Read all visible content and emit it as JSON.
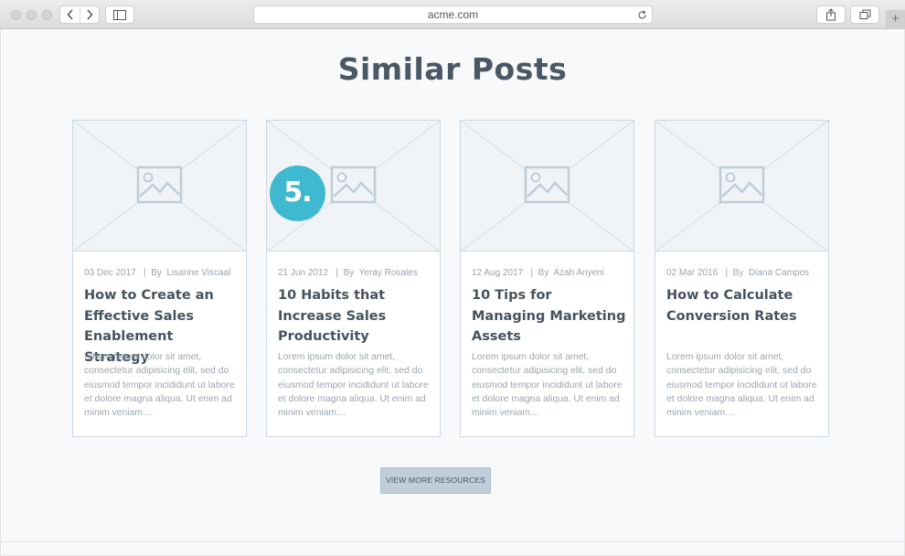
{
  "browser": {
    "url": "acme.com",
    "icons": {
      "back": "chevron-left-icon",
      "forward": "chevron-right-icon",
      "sidebar": "sidebar-icon",
      "reload": "reload-icon",
      "share": "share-icon",
      "tabs": "tabs-icon",
      "new_tab": "plus-icon"
    },
    "new_tab_label": "+"
  },
  "page": {
    "heading": "Similar Posts",
    "badge": "5.",
    "view_more_label": "VIEW MORE RESOURCES"
  },
  "posts": [
    {
      "date": "03 Dec 2017",
      "by": "By",
      "author": "Lisanne Viscaal",
      "title": "How to Create an Effective Sales Enablement Strategy",
      "excerpt": "Lorem ipsum dolor sit amet, consectetur adipisicing elit, sed do eiusmod tempor incididunt ut labore et dolore magna aliqua. Ut enim ad minim veniam…"
    },
    {
      "date": "21 Jun 2012",
      "by": "By",
      "author": "Yeray Rosales",
      "title": "10 Habits that Increase Sales Productivity",
      "excerpt": "Lorem ipsum dolor sit amet, consectetur adipisicing elit, sed do eiusmod tempor incididunt ut labore et dolore magna aliqua. Ut enim ad minim veniam…"
    },
    {
      "date": "12 Aug 2017",
      "by": "By",
      "author": "Azah Anyeni",
      "title": "10 Tips for Managing Marketing Assets",
      "excerpt": "Lorem ipsum dolor sit amet, consectetur adipisicing elit, sed do eiusmod tempor incididunt ut labore et dolore magna aliqua. Ut enim ad minim veniam…"
    },
    {
      "date": "02 Mar 2016",
      "by": "By",
      "author": "Diana Campos",
      "title": "How to Calculate Conversion Rates",
      "excerpt": "Lorem ipsum dolor sit amet, consectetur adipisicing elit, sed do eiusmod tempor incididunt ut labore et dolore magna aliqua. Ut enim ad minim veniam…"
    }
  ],
  "colors": {
    "badge": "#3fb9cf",
    "heading": "#4a5865",
    "button": "#bfced9"
  }
}
